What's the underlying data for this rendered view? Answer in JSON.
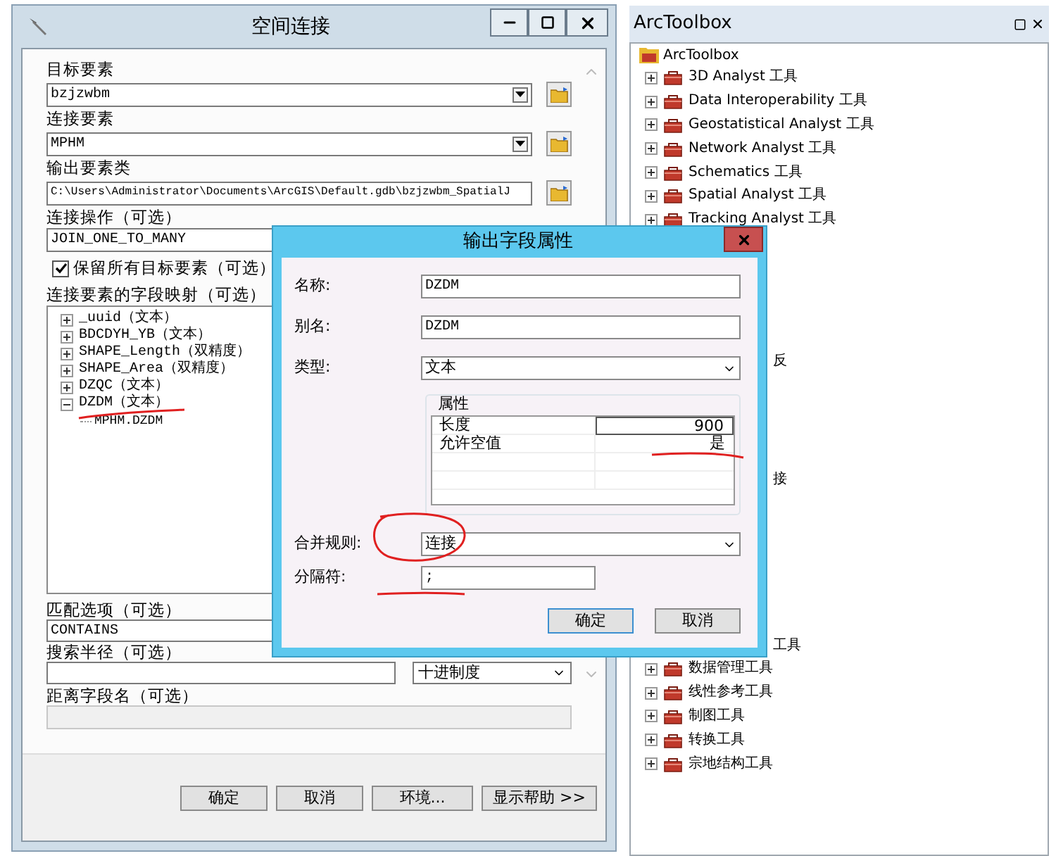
{
  "main_window": {
    "title": "空间连接",
    "target_features": {
      "label": "目标要素",
      "value": "bzjzwbm"
    },
    "join_features": {
      "label": "连接要素",
      "value": "MPHM"
    },
    "output_feature_class": {
      "label": "输出要素类",
      "value": "C:\\Users\\Administrator\\Documents\\ArcGIS\\Default.gdb\\bzjzwbm_SpatialJ"
    },
    "join_operation": {
      "label": "连接操作（可选）",
      "value": "JOIN_ONE_TO_MANY"
    },
    "keep_all": {
      "label": "保留所有目标要素（可选）",
      "checked": true
    },
    "field_map": {
      "label": "连接要素的字段映射（可选）",
      "items": [
        {
          "label": "_uuid（文本）",
          "expanded": false
        },
        {
          "label": "BDCDYH_YB（文本）",
          "expanded": false
        },
        {
          "label": "SHAPE_Length（双精度）",
          "expanded": false
        },
        {
          "label": "SHAPE_Area（双精度）",
          "expanded": false
        },
        {
          "label": "DZQC（文本）",
          "expanded": false
        },
        {
          "label": "DZDM（文本）",
          "expanded": true,
          "children": [
            {
              "label": "MPHM.DZDM"
            }
          ]
        }
      ]
    },
    "match_option": {
      "label": "匹配选项（可选）",
      "value": "CONTAINS"
    },
    "search_radius": {
      "label": "搜索半径（可选）",
      "unit": "十进制度"
    },
    "distance_field": {
      "label": "距离字段名（可选）"
    },
    "buttons": [
      "确定",
      "取消",
      "环境...",
      "显示帮助 >>"
    ]
  },
  "toolbox": {
    "title": "ArcToolbox",
    "root": "ArcToolbox",
    "items": [
      {
        "kind": "tool",
        "label": "3D Analyst 工具",
        "expanded": false
      },
      {
        "kind": "tool",
        "label": "Data Interoperability 工具",
        "expanded": false
      },
      {
        "kind": "tool",
        "label": "Geostatistical Analyst 工具",
        "expanded": false
      },
      {
        "kind": "tool",
        "label": "Network Analyst 工具",
        "expanded": false
      },
      {
        "kind": "tool",
        "label": "Schematics 工具",
        "expanded": false
      },
      {
        "kind": "tool",
        "label": "Spatial Analyst 工具",
        "expanded": false
      },
      {
        "kind": "tool",
        "label": "Tracking Analyst 工具",
        "expanded": false
      },
      {
        "kind": "fragment",
        "label": "反"
      },
      {
        "kind": "fragment",
        "label": "接"
      },
      {
        "kind": "fragment",
        "label": "工具"
      },
      {
        "kind": "tool",
        "label": "数据管理工具",
        "expanded": false
      },
      {
        "kind": "tool",
        "label": "线性参考工具",
        "expanded": false
      },
      {
        "kind": "tool",
        "label": "制图工具",
        "expanded": false
      },
      {
        "kind": "tool",
        "label": "转换工具",
        "expanded": false
      },
      {
        "kind": "tool",
        "label": "宗地结构工具",
        "expanded": false
      }
    ]
  },
  "dialog": {
    "title": "输出字段属性",
    "name": {
      "label": "名称:",
      "value": "DZDM"
    },
    "alias": {
      "label": "别名:",
      "value": "DZDM"
    },
    "type": {
      "label": "类型:",
      "value": "文本"
    },
    "properties": {
      "title": "属性",
      "rows": [
        {
          "name": "长度",
          "value": "900",
          "editing": true
        },
        {
          "name": "允许空值",
          "value": "是",
          "editing": false
        }
      ]
    },
    "merge_rule": {
      "label": "合并规则:",
      "value": "连接"
    },
    "delimiter": {
      "label": "分隔符:",
      "value": ";"
    },
    "buttons": [
      "确定",
      "取消"
    ]
  }
}
